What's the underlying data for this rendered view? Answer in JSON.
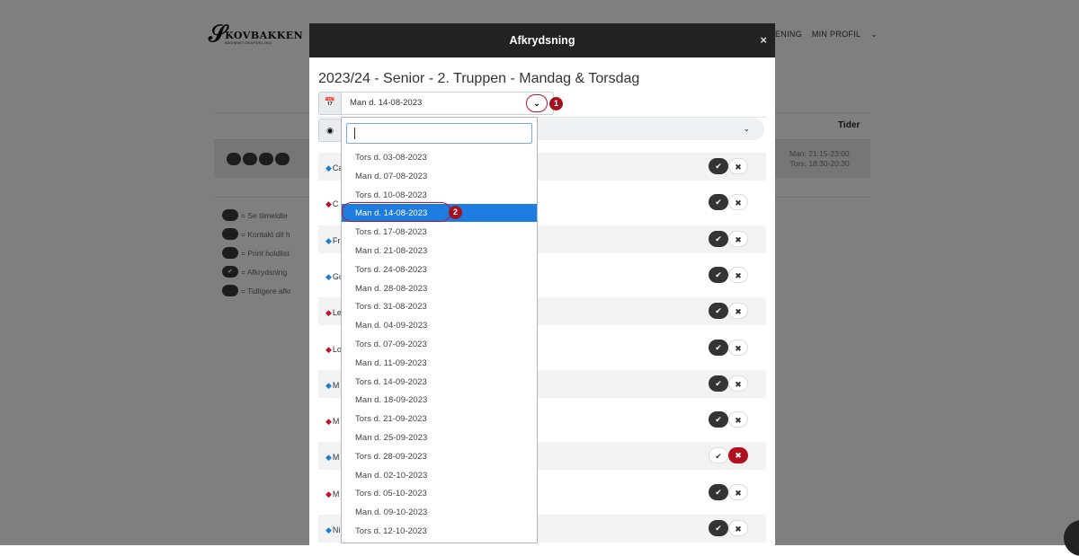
{
  "background": {
    "logo_name": "KOVBAKKEN",
    "logo_sub": "BADMINTONAFDELING",
    "nav": [
      "ENING",
      "MIN PROFIL"
    ],
    "table_header_tider": "Tider",
    "tider_values": [
      "Man: 21:15-23:00",
      "Tors: 18:30-20:30"
    ],
    "legend": [
      "= Se tilmeldte",
      "= Kontakt dit h",
      "= Print holdlist",
      "= Afkrydsning",
      "= Tidligere afkr"
    ]
  },
  "modal": {
    "title": "Afkrydsning",
    "close": "×",
    "heading": "2023/24 - Senior - 2. Truppen - Mandag & Torsdag",
    "date_select_value": "Man d. 14-08-2023",
    "annotation_1": "1",
    "annotation_2": "2",
    "rows": [
      {
        "prefix": "Ca",
        "gender": "m",
        "state": "none"
      },
      {
        "prefix": "C",
        "gender": "f",
        "state": "none"
      },
      {
        "prefix": "Fr",
        "gender": "m",
        "state": "none"
      },
      {
        "prefix": "Gu",
        "gender": "m",
        "state": "none"
      },
      {
        "prefix": "Le",
        "gender": "f",
        "state": "none"
      },
      {
        "prefix": "Lo",
        "gender": "f",
        "state": "none"
      },
      {
        "prefix": "M",
        "gender": "m",
        "state": "none"
      },
      {
        "prefix": "M",
        "gender": "f",
        "state": "none"
      },
      {
        "prefix": "M",
        "gender": "m",
        "state": "declined"
      },
      {
        "prefix": "M",
        "gender": "f",
        "state": "none"
      },
      {
        "prefix": "Ni",
        "gender": "m",
        "state": "none"
      }
    ]
  },
  "dropdown": {
    "search_value": "",
    "selected_index": 3,
    "options": [
      "Tors d. 03-08-2023",
      "Man d. 07-08-2023",
      "Tors d. 10-08-2023",
      "Man d. 14-08-2023",
      "Tors d. 17-08-2023",
      "Man d. 21-08-2023",
      "Tors d. 24-08-2023",
      "Man d. 28-08-2023",
      "Tors d. 31-08-2023",
      "Man d. 04-09-2023",
      "Tors d. 07-09-2023",
      "Man d. 11-09-2023",
      "Tors d. 14-09-2023",
      "Man d. 18-09-2023",
      "Tors d. 21-09-2023",
      "Man d. 25-09-2023",
      "Tors d. 28-09-2023",
      "Man d. 02-10-2023",
      "Tors d. 05-10-2023",
      "Man d. 09-10-2023",
      "Tors d. 12-10-2023"
    ]
  },
  "colors": {
    "accent": "#1e7be0",
    "annotation_red": "#a5121f",
    "male": "#1e7fd0",
    "female": "#c0112a"
  },
  "icons": [
    "calendar-icon",
    "chevron-down-icon",
    "user-circle-icon",
    "check-icon",
    "x-icon",
    "male-icon",
    "female-icon",
    "close-icon"
  ]
}
